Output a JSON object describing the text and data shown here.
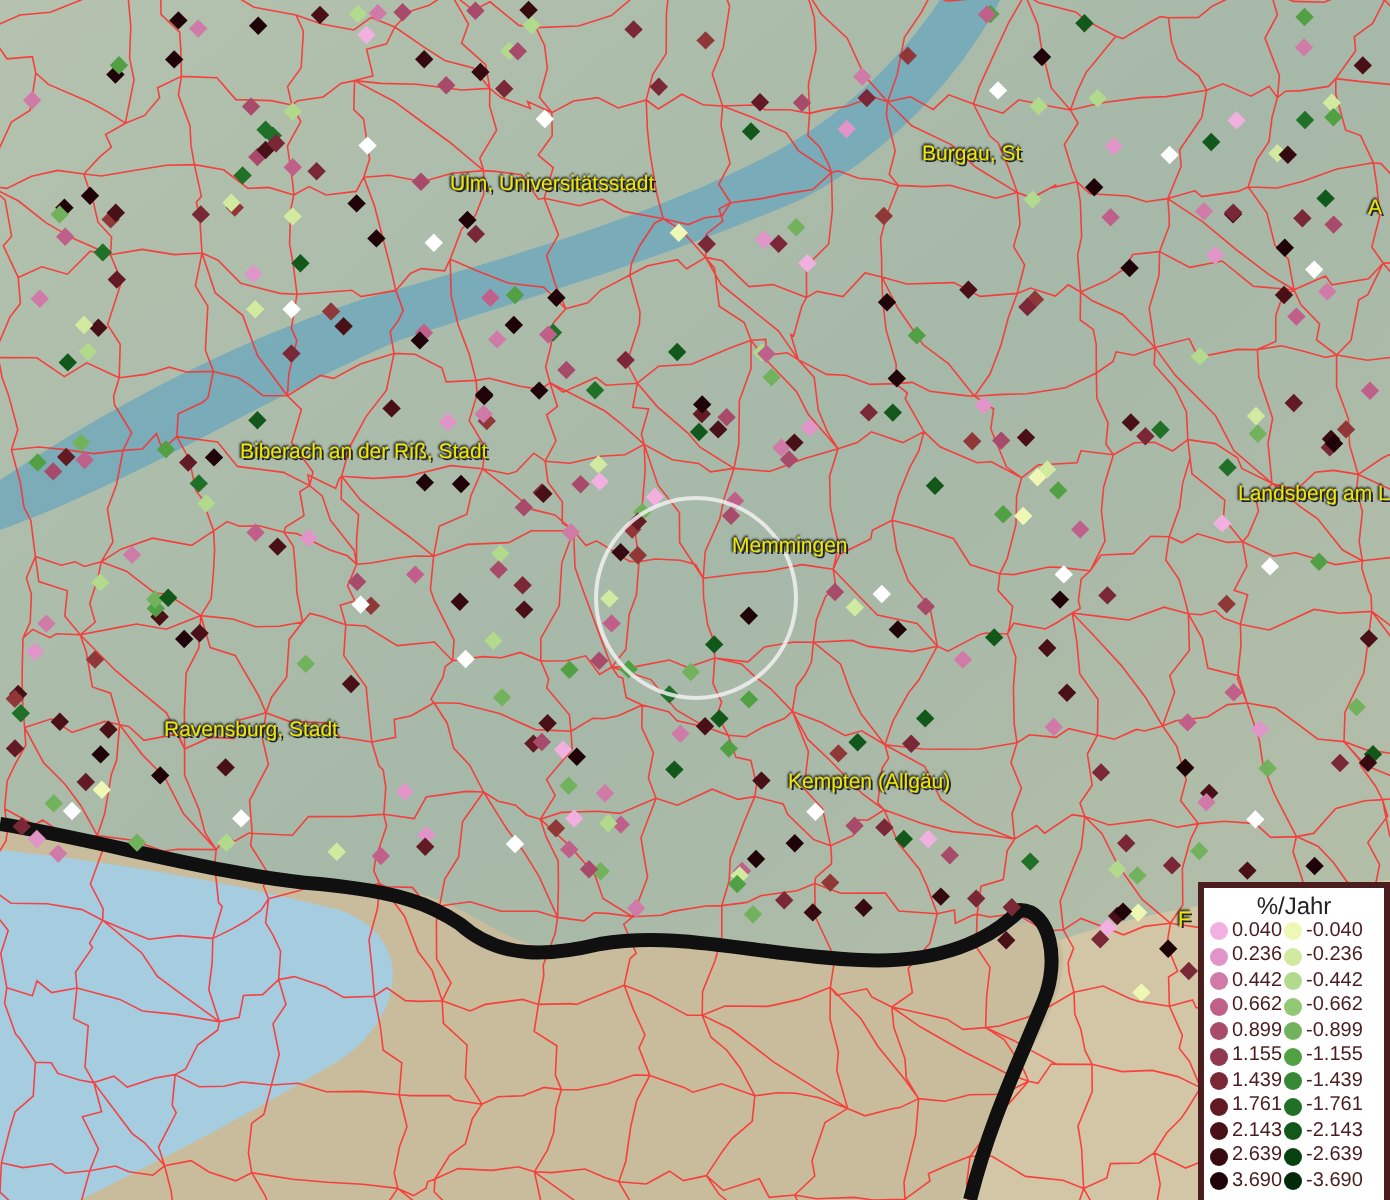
{
  "map": {
    "place_labels": [
      {
        "text": "Ulm, Universitätsstadt"
      },
      {
        "text": "Burgau, St"
      },
      {
        "text": "A"
      },
      {
        "text": "Biberach an der Riß, Stadt"
      },
      {
        "text": "Landsberg am L"
      },
      {
        "text": "Memmingen"
      },
      {
        "text": "Ravensburg, Stadt"
      },
      {
        "text": "Kempten (Allgäu)"
      },
      {
        "text": "F"
      }
    ]
  },
  "legend": {
    "title": "%/Jahr",
    "columns": [
      {
        "items": [
          {
            "value": "0.040",
            "color": "#f2b0e0"
          },
          {
            "value": "0.236",
            "color": "#e094c8"
          },
          {
            "value": "0.442",
            "color": "#d07aa8"
          },
          {
            "value": "0.662",
            "color": "#c0608a"
          },
          {
            "value": "0.899",
            "color": "#a84a6a"
          },
          {
            "value": "1.155",
            "color": "#903850"
          },
          {
            "value": "1.439",
            "color": "#7a2838"
          },
          {
            "value": "1.761",
            "color": "#621a24"
          },
          {
            "value": "2.143",
            "color": "#4a1018"
          },
          {
            "value": "2.639",
            "color": "#360a10"
          },
          {
            "value": "3.690",
            "color": "#200308"
          }
        ]
      },
      {
        "items": [
          {
            "value": "-0.040",
            "color": "#eef8b4"
          },
          {
            "value": "-0.236",
            "color": "#d2eaa0"
          },
          {
            "value": "-0.442",
            "color": "#b2da8c"
          },
          {
            "value": "-0.662",
            "color": "#92c874"
          },
          {
            "value": "-0.899",
            "color": "#72b25c"
          },
          {
            "value": "-1.155",
            "color": "#52a044"
          },
          {
            "value": "-1.439",
            "color": "#368834"
          },
          {
            "value": "-1.761",
            "color": "#207028"
          },
          {
            "value": "-2.143",
            "color": "#12581a"
          },
          {
            "value": "-2.639",
            "color": "#084210"
          },
          {
            "value": "-3.690",
            "color": "#022a08"
          }
        ]
      }
    ]
  }
}
